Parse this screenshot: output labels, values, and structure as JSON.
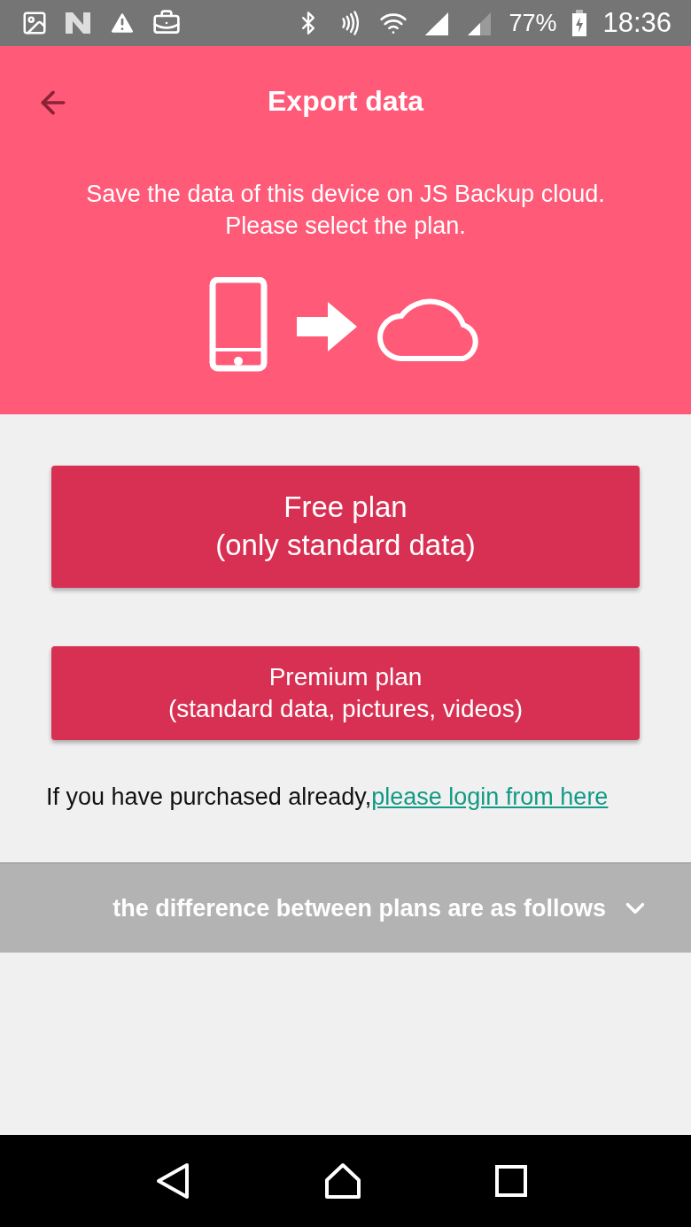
{
  "status_bar": {
    "battery": "77%",
    "time": "18:36"
  },
  "header": {
    "title": "Export data",
    "description": [
      "Save the data of this device on JS Backup cloud.",
      "Please select the plan."
    ]
  },
  "plans": [
    {
      "kind": "large",
      "title": "Free plan",
      "subtitle": "(only standard data)"
    },
    {
      "kind": "small",
      "title": "Premium plan",
      "subtitle": "(standard data, pictures, videos)"
    }
  ],
  "login_note": {
    "text": "If you have purchased already,",
    "link": "please login from here"
  },
  "differences_bar": {
    "label": "the difference between plans are as follows",
    "expanded": false
  }
}
